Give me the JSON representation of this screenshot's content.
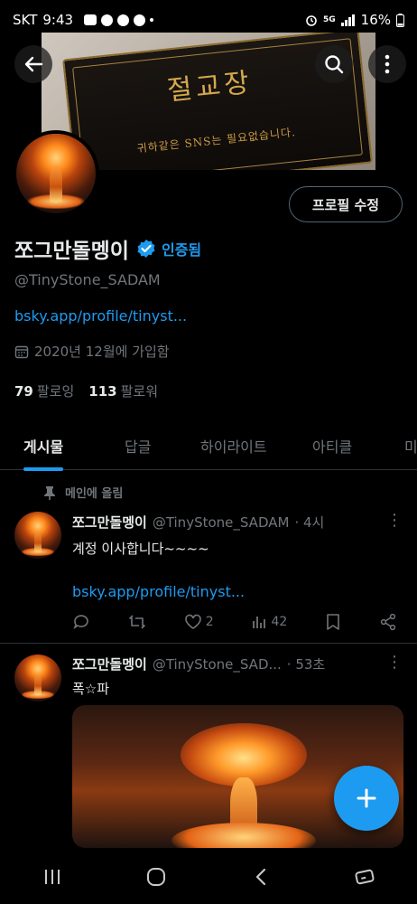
{
  "status_bar": {
    "carrier": "SKT",
    "time": "9:43",
    "network": "5G",
    "battery": "16%"
  },
  "banner": {
    "title": "절교장",
    "subtitle": "귀하같은 SNS는 필요없습니다."
  },
  "profile": {
    "edit_button": "프로필 수정",
    "name": "쪼그만돌멩이",
    "verified_label": "인증됨",
    "handle": "@TinyStone_SADAM",
    "link": "bsky.app/profile/tinyst...",
    "joined": "2020년 12월에 가입함",
    "following_count": "79",
    "following_label": "팔로잉",
    "followers_count": "113",
    "followers_label": "팔로워"
  },
  "tabs": [
    {
      "label": "게시물",
      "active": true
    },
    {
      "label": "답글",
      "active": false
    },
    {
      "label": "하이라이트",
      "active": false
    },
    {
      "label": "아티클",
      "active": false
    },
    {
      "label": "미",
      "active": false
    }
  ],
  "pinned_label": "메인에 올림",
  "posts": [
    {
      "name": "쪼그만돌멩이",
      "handle": "@TinyStone_SADAM",
      "time": "· 4시",
      "text": "계정 이사합니다~~~~",
      "link": "bsky.app/profile/tinyst...",
      "likes": "2",
      "views": "42"
    },
    {
      "name": "쪼그만돌멩이",
      "handle": "@TinyStone_SAD...",
      "time": "· 53초",
      "text": "폭☆파"
    }
  ],
  "colors": {
    "accent": "#1d9bf0",
    "background": "#000000",
    "muted": "#71767b"
  }
}
